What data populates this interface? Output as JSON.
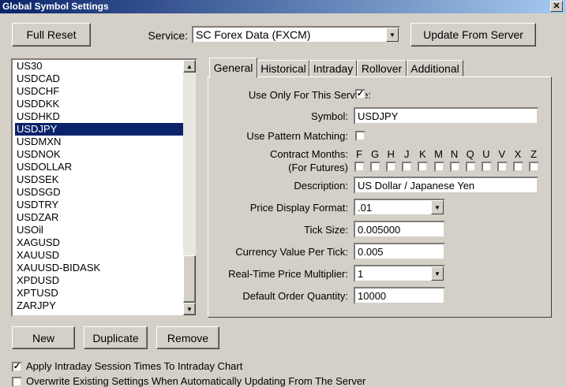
{
  "window": {
    "title": "Global Symbol Settings",
    "close": "✕"
  },
  "toolbar": {
    "full_reset": "Full Reset",
    "service_label": "Service:",
    "service_value": "SC Forex Data (FXCM)",
    "update_button": "Update From Server"
  },
  "symbol_list": {
    "items": [
      "US30",
      "USDCAD",
      "USDCHF",
      "USDDKK",
      "USDHKD",
      "USDJPY",
      "USDMXN",
      "USDNOK",
      "USDOLLAR",
      "USDSEK",
      "USDSGD",
      "USDTRY",
      "USDZAR",
      "USOil",
      "XAGUSD",
      "XAUUSD",
      "XAUUSD-BIDASK",
      "XPDUSD",
      "XPTUSD",
      "ZARJPY"
    ],
    "selected": "USDJPY"
  },
  "tabs": [
    "General",
    "Historical",
    "Intraday",
    "Rollover",
    "Additional"
  ],
  "general": {
    "use_only_label": "Use Only For This Service:",
    "use_only_checked": true,
    "symbol_label": "Symbol:",
    "symbol_value": "USDJPY",
    "pattern_label": "Use Pattern Matching:",
    "pattern_checked": false,
    "contract_label": "Contract Months:",
    "contract_sub": "(For Futures)",
    "months": [
      "F",
      "G",
      "H",
      "J",
      "K",
      "M",
      "N",
      "Q",
      "U",
      "V",
      "X",
      "Z"
    ],
    "description_label": "Description:",
    "description_value": "US Dollar / Japanese Yen",
    "price_format_label": "Price Display Format:",
    "price_format_value": ".01",
    "tick_size_label": "Tick Size:",
    "tick_size_value": "0.005000",
    "currency_value_label": "Currency Value Per Tick:",
    "currency_value_value": "0.005",
    "multiplier_label": "Real-Time Price Multiplier:",
    "multiplier_value": "1",
    "order_qty_label": "Default Order Quantity:",
    "order_qty_value": "10000"
  },
  "buttons": {
    "new": "New",
    "duplicate": "Duplicate",
    "remove": "Remove"
  },
  "options": {
    "apply_intraday_label": "Apply Intraday Session Times To Intraday Chart",
    "apply_intraday_checked": true,
    "overwrite_label": "Overwrite Existing Settings When Automatically Updating From The Server",
    "overwrite_checked": false
  }
}
